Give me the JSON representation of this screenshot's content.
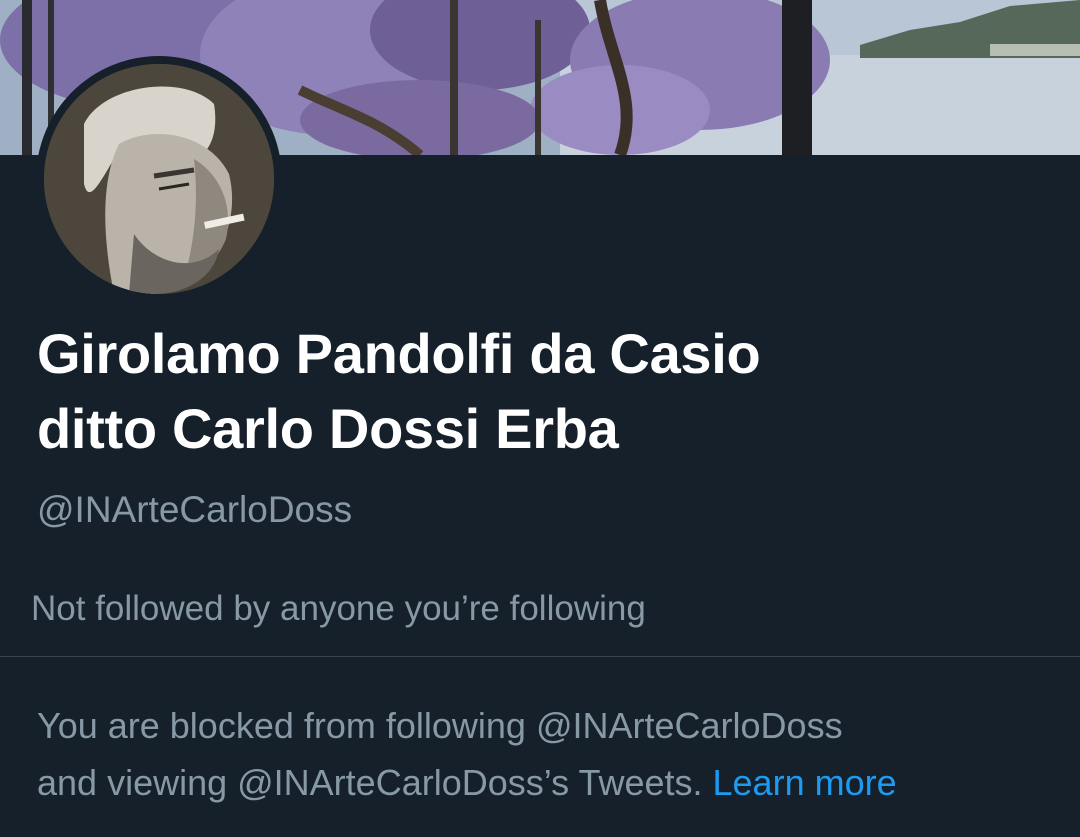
{
  "profile": {
    "display_name_line1": "Girolamo Pandolfi da Casio",
    "display_name_line2": "ditto Carlo Dossi Erba",
    "handle": "@INArteCarloDoss",
    "followed_by_text": "Not followed by anyone you’re following",
    "blocked_text_line1": "You are blocked from following @INArteCarloDoss",
    "blocked_text_line2": "and viewing @INArteCarloDoss’s Tweets.",
    "learn_more_label": "Learn more"
  },
  "colors": {
    "background": "#15202b",
    "primary_text": "#ffffff",
    "secondary_text": "#8899a6",
    "link": "#1d9bf0",
    "divider": "#38444d"
  }
}
